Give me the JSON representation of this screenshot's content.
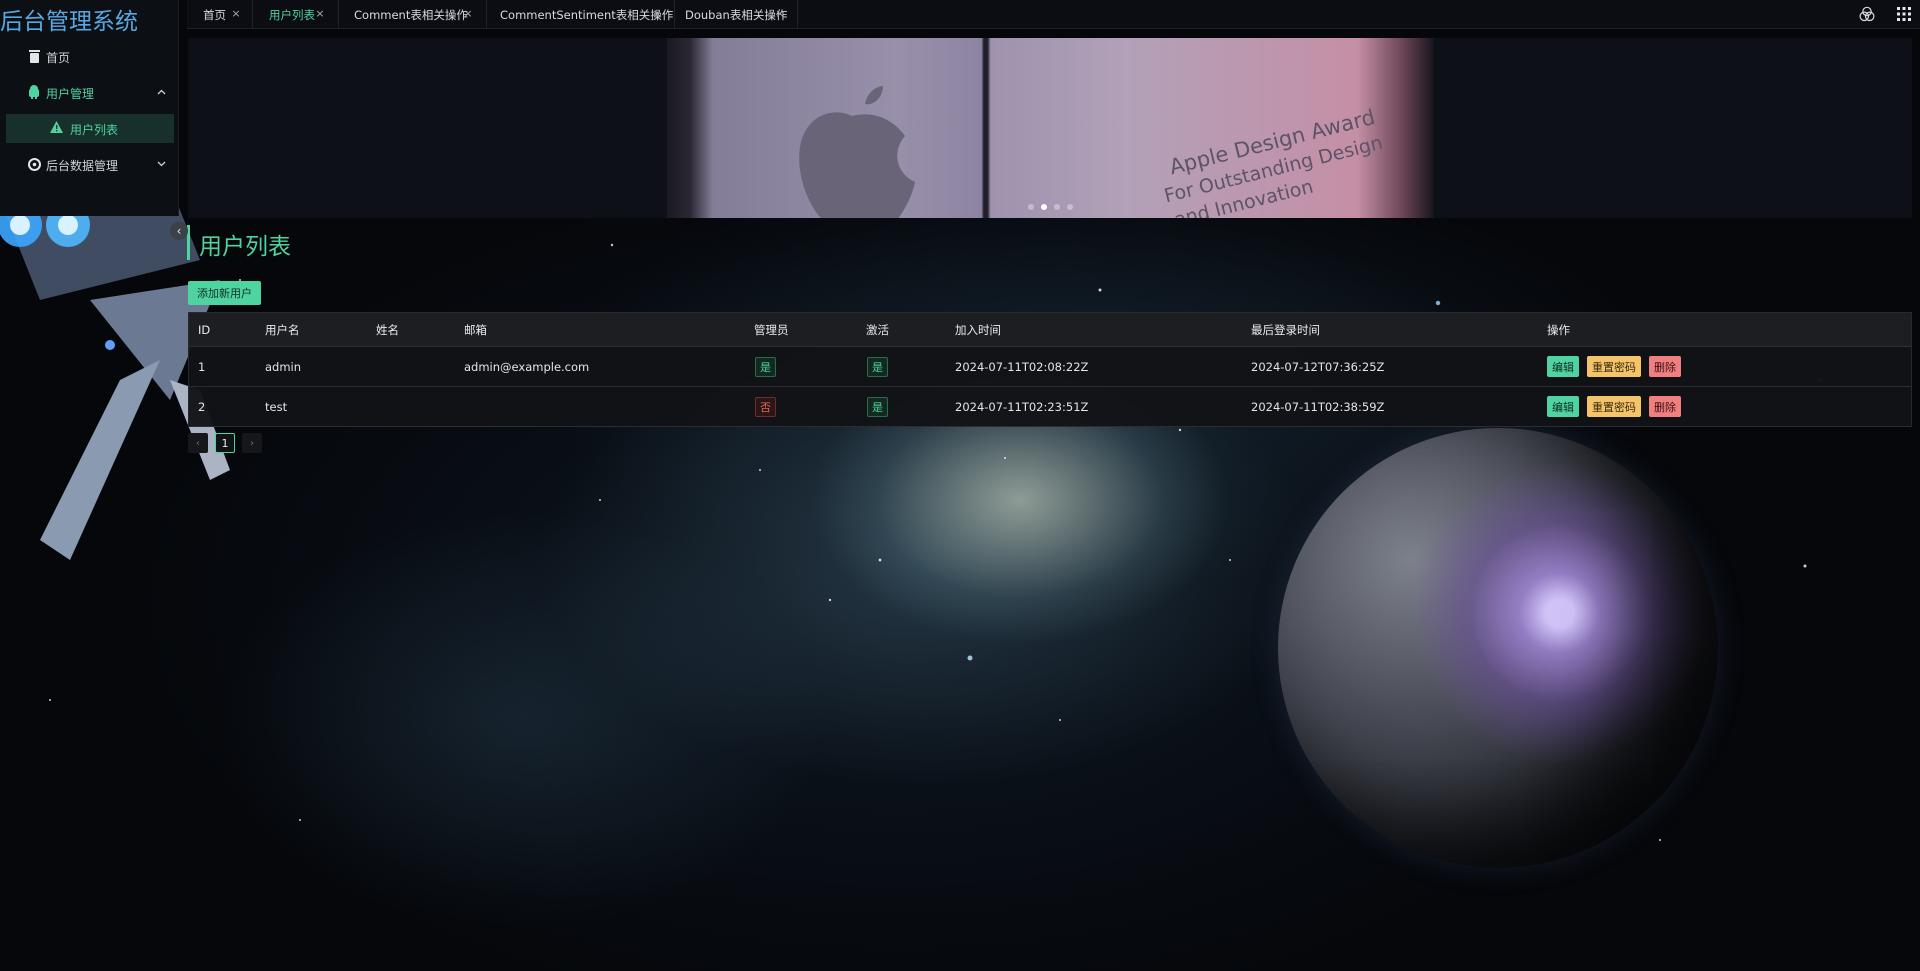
{
  "app": {
    "title": "后台管理系统"
  },
  "sidebar": {
    "items": [
      {
        "label": "首页",
        "icon": "trash-icon"
      },
      {
        "label": "用户管理",
        "icon": "android-icon",
        "arrow": "chevron-up-icon"
      },
      {
        "label": "用户列表",
        "icon": "warning-icon"
      },
      {
        "label": "后台数据管理",
        "icon": "settings-icon",
        "arrow": "chevron-down-icon"
      }
    ]
  },
  "tabs": [
    {
      "label": "首页",
      "close": "×"
    },
    {
      "label": "用户列表",
      "close": "×"
    },
    {
      "label": "Comment表相关操作",
      "close": "×"
    },
    {
      "label": "CommentSentiment表相关操作",
      "close": "×"
    },
    {
      "label": "Douban表相关操作",
      "close": "×"
    }
  ],
  "toolbar": {
    "theme_icon": "color-circles-icon",
    "apps_icon": "grid-icon"
  },
  "banner": {
    "slide_text": [
      "Apple Design Award",
      "For Outstanding Design",
      "and Innovation"
    ],
    "dot_count": 4,
    "active_dot": 2
  },
  "page": {
    "title": "用户列表",
    "add_label": "添加新用户",
    "collapse_icon": "‹"
  },
  "table": {
    "headers": [
      "ID",
      "用户名",
      "姓名",
      "邮箱",
      "管理员",
      "激活",
      "加入时间",
      "最后登录时间",
      "操作"
    ],
    "rows": [
      {
        "id": "1",
        "username": "admin",
        "name": "",
        "email": "admin@example.com",
        "is_admin": "是",
        "active": "是",
        "joined": "2024-07-11T02:08:22Z",
        "last_login": "2024-07-12T07:36:25Z"
      },
      {
        "id": "2",
        "username": "test",
        "name": "",
        "email": "",
        "is_admin": "否",
        "active": "是",
        "joined": "2024-07-11T02:23:51Z",
        "last_login": "2024-07-11T02:38:59Z"
      }
    ],
    "actions": {
      "edit": "编辑",
      "reset": "重置密码",
      "delete": "删除"
    }
  },
  "pagination": {
    "prev": "‹",
    "current": "1",
    "next": "›"
  },
  "colors": {
    "accent": "#4fd3a0",
    "warning": "#f4c46b",
    "danger": "#f07f7f",
    "brand": "#56a9e3"
  }
}
